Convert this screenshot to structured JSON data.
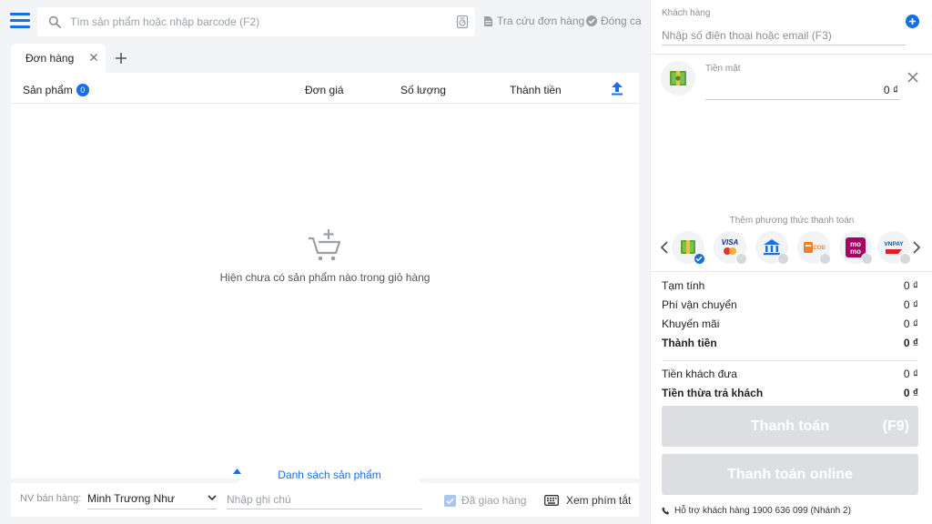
{
  "search": {
    "placeholder": "Tìm sản phẩm hoặc nhập barcode (F2)"
  },
  "header": {
    "lookup_orders": "Tra cứu đơn hàng",
    "close_shift": "Đóng ca"
  },
  "tabs": [
    {
      "label": "Đơn hàng"
    }
  ],
  "cart": {
    "columns": {
      "product": "Sản phẩm",
      "price": "Đơn giá",
      "quantity": "Số lượng",
      "total": "Thành tiền"
    },
    "product_count": "0",
    "empty_text": "Hiện chưa có sản phẩm nào trong giỏ hàng",
    "product_list_label": "Danh sách sản phẩm"
  },
  "footer": {
    "staff_label": "NV bán hàng:",
    "staff_value": "Minh Trương Như",
    "note_placeholder": "Nhập ghi chú",
    "delivered_label": "Đã giao hàng",
    "shortcut_label": "Xem phím tắt"
  },
  "customer": {
    "label": "Khách hàng",
    "placeholder": "Nhập số điện thoại hoặc email (F3)"
  },
  "payment": {
    "method_label": "Tiền mặt",
    "amount": "0 ₫",
    "add_method_label": "Thêm phương thức thanh toán",
    "methods": [
      {
        "icon": "cash-icon",
        "selected": true
      },
      {
        "icon": "visa-card-icon",
        "text": "VISA",
        "selected": false
      },
      {
        "icon": "bank-transfer-icon",
        "selected": false
      },
      {
        "icon": "cod-icon",
        "text": "COD",
        "selected": false
      },
      {
        "icon": "momo-icon",
        "text": "mo mo",
        "selected": false
      },
      {
        "icon": "vnpay-icon",
        "text": "VNPAY",
        "selected": false
      }
    ]
  },
  "summary": {
    "subtotal_label": "Tạm tính",
    "subtotal": "0 ₫",
    "shipping_label": "Phí vận chuyển",
    "shipping": "0 ₫",
    "discount_label": "Khuyến mãi",
    "discount": "0 ₫",
    "total_label": "Thành tiền",
    "total": "0 ₫",
    "given_label": "Tiền khách đưa",
    "given": "0 ₫",
    "change_label": "Tiền thừa trả khách",
    "change": "0 ₫"
  },
  "actions": {
    "pay_label": "Thanh toán",
    "pay_key": "(F9)",
    "online_label": "Thanh toán online"
  },
  "support": {
    "text": "Hỗ trợ khách hàng 1900 636 099 (Nhánh 2)"
  },
  "colors": {
    "accent": "#1a6fe0",
    "disabled_button": "#dcdee1"
  }
}
